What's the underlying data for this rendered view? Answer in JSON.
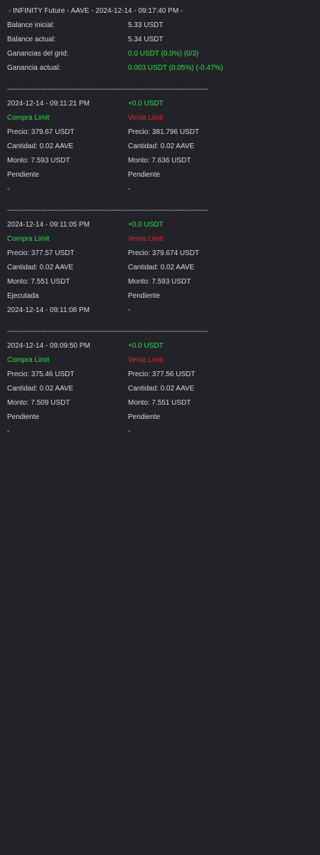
{
  "header": {
    "title": " - INFINITY Future - AAVE - 2024-12-14 - 09:17:40 PM -"
  },
  "summary": [
    {
      "label": "Balance inicial:",
      "value": "5.33 USDT",
      "value_color": "normal"
    },
    {
      "label": "Balance actual:",
      "value": "5.34 USDT",
      "value_color": "normal"
    },
    {
      "label": "Ganancias del grid:",
      "value": "0.0 USDT (0.0%) (0/3)",
      "value_color": "green"
    },
    {
      "label": "Ganancia actual:",
      "value": "0.003 USDT (0.05%) (-0.47%)",
      "value_color": "green"
    }
  ],
  "separator": "----------------------------------------------------------------------------------------------------------------------------------------------",
  "orders": [
    {
      "timestamp": "2024-12-14 - 09:11:21 PM",
      "profit": "+0.0 USDT",
      "buy": {
        "type": "Compra Limit",
        "price": "Precio: 379.67 USDT",
        "quantity": "Cantidad: 0.02 AAVE",
        "amount": "Monto: 7.593 USDT",
        "status": "Pendiente",
        "executed_at": "-"
      },
      "sell": {
        "type": "Venta Limit",
        "price": "Precio: 381.796 USDT",
        "quantity": "Cantidad: 0.02 AAVE",
        "amount": "Monto: 7.636 USDT",
        "status": "Pendiente",
        "executed_at": "-"
      }
    },
    {
      "timestamp": "2024-12-14 - 09:11:05 PM",
      "profit": "+0.0 USDT",
      "buy": {
        "type": "Compra Limit",
        "price": "Precio: 377.57 USDT",
        "quantity": "Cantidad: 0.02 AAVE",
        "amount": "Monto: 7.551 USDT",
        "status": "Ejecutada",
        "executed_at": "2024-12-14 - 09:11:08 PM"
      },
      "sell": {
        "type": "Venta Limit",
        "price": "Precio: 379.674 USDT",
        "quantity": "Cantidad: 0.02 AAVE",
        "amount": "Monto: 7.593 USDT",
        "status": "Pendiente",
        "executed_at": "-"
      }
    },
    {
      "timestamp": "2024-12-14 - 09:09:50 PM",
      "profit": "+0.0 USDT",
      "buy": {
        "type": "Compra Limit",
        "price": "Precio: 375.46 USDT",
        "quantity": "Cantidad: 0.02 AAVE",
        "amount": "Monto: 7.509 USDT",
        "status": "Pendiente",
        "executed_at": "-"
      },
      "sell": {
        "type": "Venta Limit",
        "price": "Precio: 377.56 USDT",
        "quantity": "Cantidad: 0.02 AAVE",
        "amount": "Monto: 7.551 USDT",
        "status": "Pendiente",
        "executed_at": "-"
      }
    }
  ],
  "colors": {
    "background": "#232228",
    "text": "#d8d8d8",
    "positive": "#27e14a",
    "sell": "#e8262c"
  }
}
